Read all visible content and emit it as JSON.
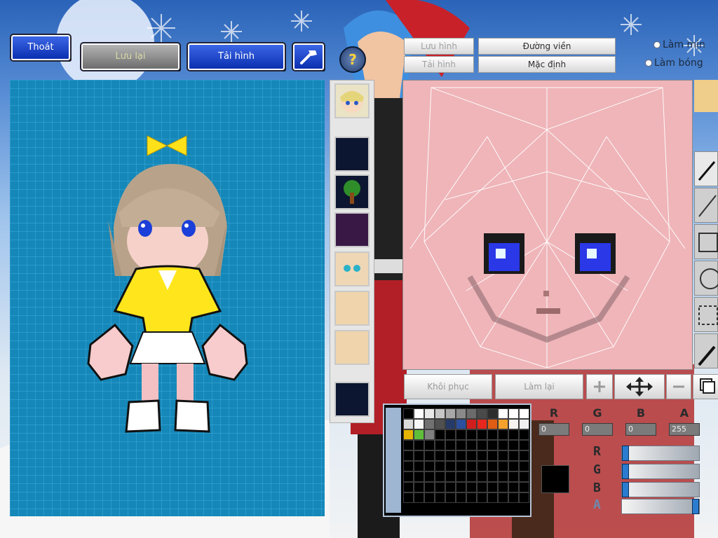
{
  "top_left": {
    "exit_label": "Thoát",
    "save_label": "Lưu lại",
    "load_label": "Tải hình"
  },
  "top_right": {
    "save_image_label": "Lưu hình",
    "load_image_label": "Tải hình",
    "outline_label": "Đường viền",
    "default_label": "Mặc định",
    "smooth_label": "Làm mịn",
    "gloss_label": "Làm bóng"
  },
  "bottom_buttons": {
    "restore_label": "Khôi phục",
    "redo_label": "Làm lại"
  },
  "palette": {
    "colors": [
      "#000000",
      "#ffffff",
      "#e8e8e8",
      "#c6c6c6",
      "#a8a8a8",
      "#8a8a8a",
      "#6b6b6b",
      "#4a4a4a",
      "#2d2d2d",
      "#ffffff",
      "#ffffff",
      "#ffffff",
      "#d9d9d9",
      "#f7f7f7",
      "#717171",
      "#505050",
      "#263a68",
      "#2c4f9e",
      "#d01e1e",
      "#e6271d",
      "#e05c13",
      "#f5a22c",
      "#f7f4f1",
      "#f0f0f0",
      "#e5b400",
      "#5fbf3a",
      "#808080"
    ],
    "filler_count": 81
  },
  "channels": {
    "r_label": "R",
    "g_label": "G",
    "b_label": "B",
    "a_label": "A",
    "r_value": "0",
    "g_value": "0",
    "b_value": "0",
    "a_value": "255"
  },
  "sliders": {
    "r_level": 0,
    "g_level": 0,
    "b_level": 0,
    "a_level": 1
  },
  "current_color": "#000000",
  "icons": {
    "help": "question-mark",
    "hammer": "hammer",
    "add": "plus",
    "move": "four-way-arrow",
    "minus": "minus",
    "copy": "stack-squares"
  }
}
